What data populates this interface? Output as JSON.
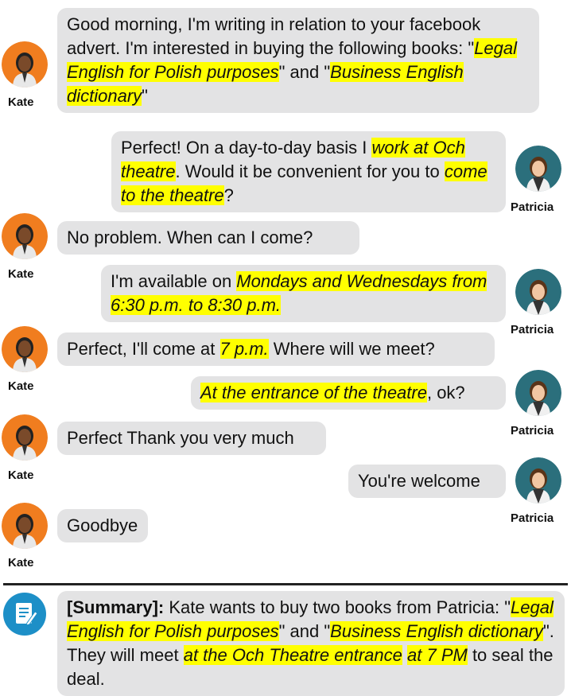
{
  "participants": {
    "kate": "Kate",
    "patricia": "Patricia"
  },
  "colors": {
    "bubble": "#e3e3e4",
    "highlight": "#ffff00",
    "kate_bg": "#f07d1f",
    "patricia_bg": "#2b6f7c",
    "summary_icon": "#1d8fc7"
  },
  "messages": [
    {
      "speaker": "Kate",
      "segments": [
        "Good morning, I'm writing in relation to your facebook advert. I'm interested in buying the following books: \"",
        "Legal English for Polish purposes",
        "\" and \"",
        "Business English dictionary",
        "\""
      ]
    },
    {
      "speaker": "Patricia",
      "segments": [
        "Perfect! On a day-to-day basis I ",
        "work at Och theatre",
        ". Would it be convenient for you to ",
        "come to the theatre",
        "?"
      ]
    },
    {
      "speaker": "Kate",
      "segments": [
        "No problem. When can I come?"
      ]
    },
    {
      "speaker": "Patricia",
      "segments": [
        "I'm available on ",
        "Mondays and Wednesdays from 6:30 p.m. to 8:30 p.m."
      ]
    },
    {
      "speaker": "Kate",
      "segments": [
        "Perfect, I'll come at ",
        "7 p.m.",
        " Where will we meet?"
      ]
    },
    {
      "speaker": "Patricia",
      "segments": [
        "At the entrance of the theatre",
        ", ok?"
      ]
    },
    {
      "speaker": "Kate",
      "segments": [
        "Perfect Thank you very much"
      ]
    },
    {
      "speaker": "Patricia",
      "segments": [
        "You're welcome"
      ]
    },
    {
      "speaker": "Kate",
      "segments": [
        "Goodbye"
      ]
    }
  ],
  "summary": {
    "label": "[Summary]:",
    "segments": [
      " Kate wants to buy two books from Patricia: \"",
      "Legal English for Polish purposes",
      "\" and \"",
      "Business English dictionary",
      "\". They will meet ",
      "at the Och Theatre entrance",
      " ",
      "at 7 PM",
      " to seal the deal."
    ]
  }
}
